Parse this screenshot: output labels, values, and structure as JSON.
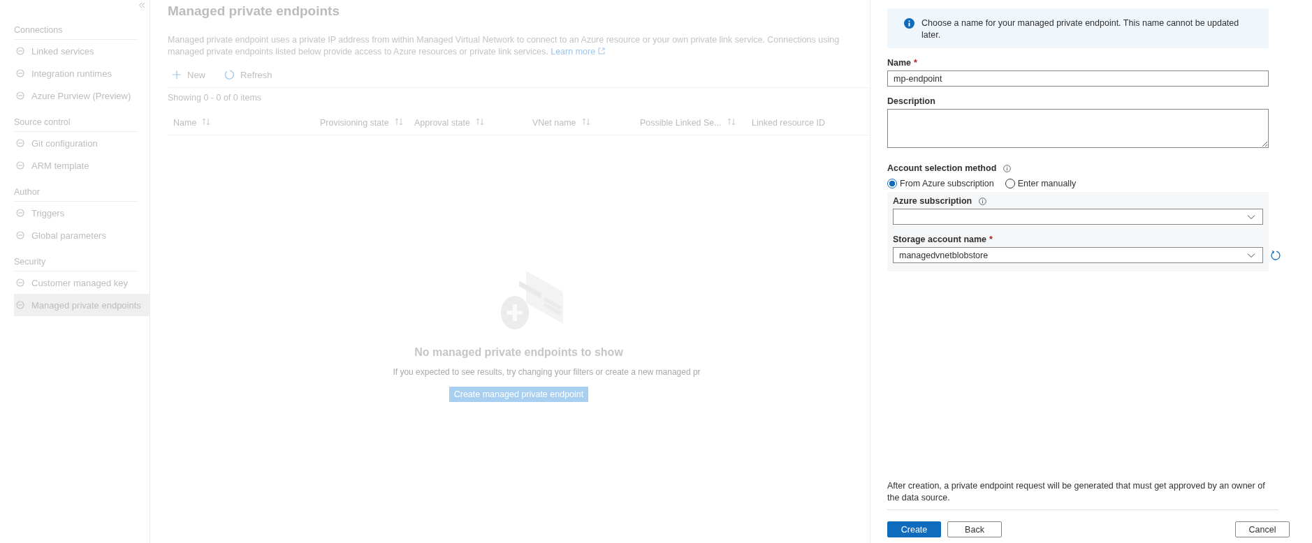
{
  "sidebar": {
    "sections": [
      {
        "title": "Connections",
        "items": [
          {
            "label": "Linked services",
            "selected": false
          },
          {
            "label": "Integration runtimes",
            "selected": false
          },
          {
            "label": "Azure Purview (Preview)",
            "selected": false
          }
        ]
      },
      {
        "title": "Source control",
        "items": [
          {
            "label": "Git configuration",
            "selected": false
          },
          {
            "label": "ARM template",
            "selected": false
          }
        ]
      },
      {
        "title": "Author",
        "items": [
          {
            "label": "Triggers",
            "selected": false
          },
          {
            "label": "Global parameters",
            "selected": false
          }
        ]
      },
      {
        "title": "Security",
        "items": [
          {
            "label": "Customer managed key",
            "selected": false
          },
          {
            "label": "Managed private endpoints",
            "selected": true
          }
        ]
      }
    ]
  },
  "main": {
    "title": "Managed private endpoints",
    "description": "Managed private endpoint uses a private IP address from within Managed Virtual Network to connect to an Azure resource or your own private link service. Connections using managed private endpoints listed below provide access to Azure resources or private link services.",
    "learn_more": "Learn more",
    "toolbar": [
      "New",
      "Refresh"
    ],
    "count": "Showing 0 - 0 of 0 items",
    "columns": [
      {
        "label": "Name",
        "sortable": true
      },
      {
        "label": "Provisioning state",
        "sortable": true
      },
      {
        "label": "Approval state",
        "sortable": true
      },
      {
        "label": "VNet name",
        "sortable": true
      },
      {
        "label": "Possible Linked Se...",
        "sortable": true
      },
      {
        "label": "Linked resource ID",
        "sortable": false
      }
    ],
    "empty": {
      "title": "No managed private endpoints to show",
      "subtitle": "If you expected to see results, try changing your filters or create a new managed pr",
      "button": "Create managed private endpoint"
    }
  },
  "panel": {
    "info": "Choose a name for your managed private endpoint. This name cannot be updated later.",
    "name": {
      "label": "Name",
      "required_mark": "*",
      "value": "mp-endpoint"
    },
    "description": {
      "label": "Description"
    },
    "method": {
      "label": "Account selection method",
      "options": [
        {
          "label": "From Azure subscription",
          "selected": true
        },
        {
          "label": "Enter manually",
          "selected": false
        }
      ]
    },
    "subscription": {
      "label": "Azure subscription"
    },
    "storage": {
      "label": "Storage account name",
      "required_mark": "*",
      "value": "managedvnetblobstore"
    },
    "note": "After creation, a private endpoint request will be generated that must get approved by an owner of the data source.",
    "buttons": {
      "create": "Create",
      "back": "Back",
      "cancel": "Cancel"
    }
  }
}
